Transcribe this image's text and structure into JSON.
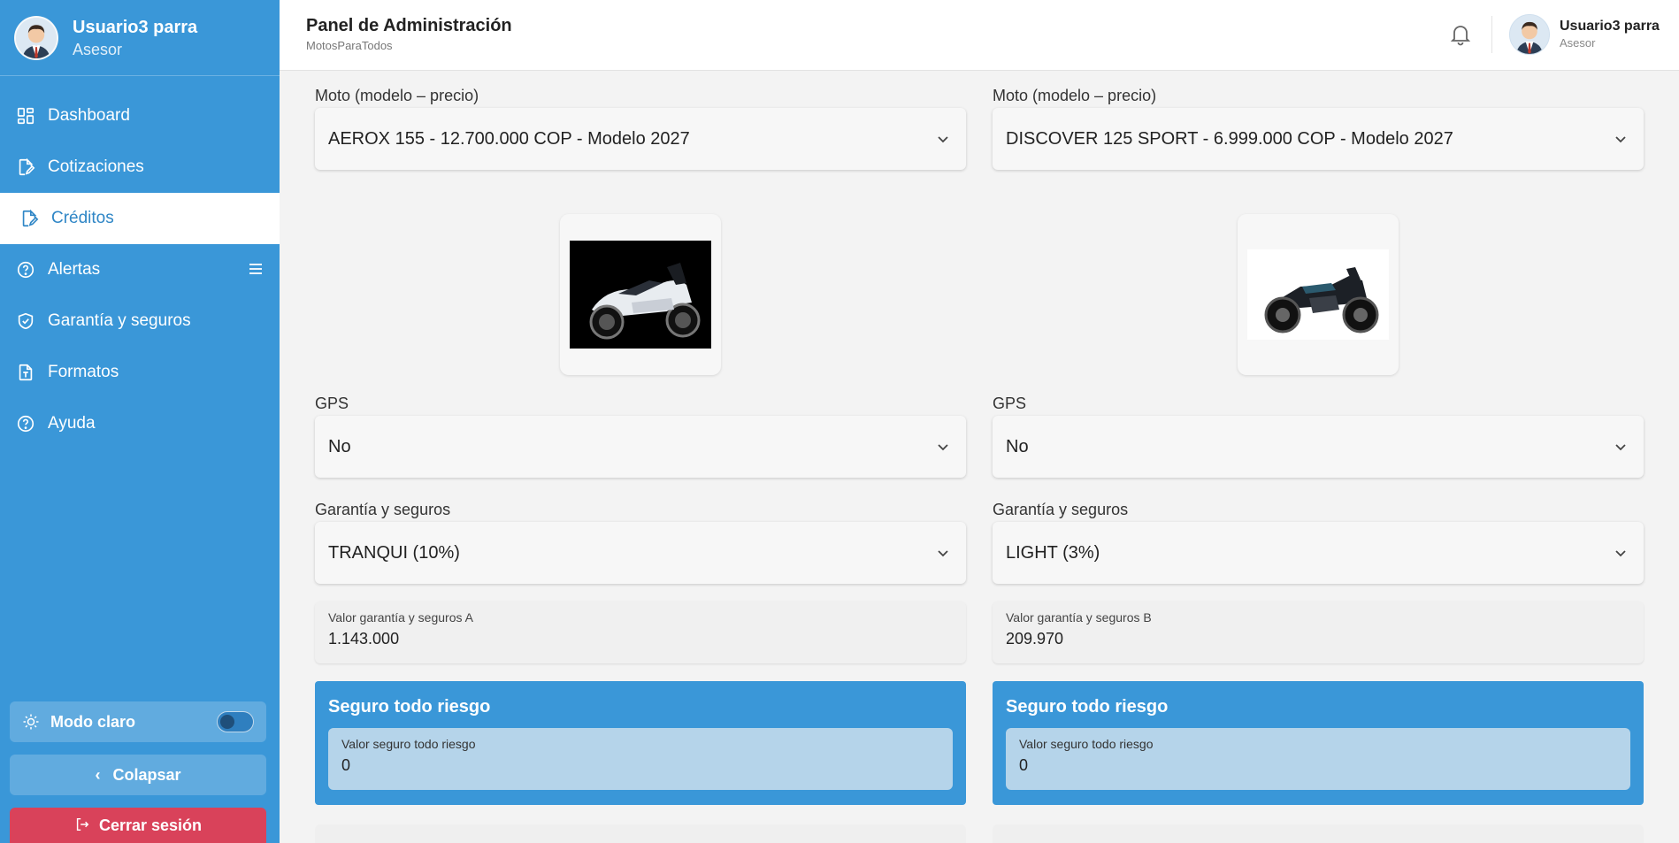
{
  "sidebar": {
    "user_name": "Usuario3 parra",
    "user_role": "Asesor",
    "items": [
      {
        "label": "Dashboard",
        "icon": "dashboard-icon"
      },
      {
        "label": "Cotizaciones",
        "icon": "document-edit-icon"
      },
      {
        "label": "Créditos",
        "icon": "document-edit-icon",
        "active": true
      },
      {
        "label": "Alertas",
        "icon": "help-circle-icon"
      },
      {
        "label": "Garantía y seguros",
        "icon": "shield-check-icon"
      },
      {
        "label": "Formatos",
        "icon": "document-text-icon"
      },
      {
        "label": "Ayuda",
        "icon": "help-circle-icon"
      }
    ],
    "mode_label": "Modo claro",
    "mode_toggle_on": false,
    "collapse_label": "Colapsar",
    "logout_label": "Cerrar sesión"
  },
  "header": {
    "title": "Panel de Administración",
    "subtitle": "MotosParaTodos",
    "user_name": "Usuario3 parra",
    "user_role": "Asesor"
  },
  "columns": [
    {
      "moto_label": "Moto (modelo – precio)",
      "moto_value": "AEROX 155 - 12.700.000 COP - Modelo 2027",
      "gps_label": "GPS",
      "gps_value": "No",
      "garantia_label": "Garantía y seguros",
      "garantia_value": "TRANQUI (10%)",
      "valor_garantia_label": "Valor garantía y seguros A",
      "valor_garantia_value": "1.143.000",
      "seguro_title": "Seguro todo riesgo",
      "seguro_label": "Valor seguro todo riesgo",
      "seguro_value": "0"
    },
    {
      "moto_label": "Moto (modelo – precio)",
      "moto_value": "DISCOVER 125 SPORT - 6.999.000 COP - Modelo 2027",
      "gps_label": "GPS",
      "gps_value": "No",
      "garantia_label": "Garantía y seguros",
      "garantia_value": "LIGHT (3%)",
      "valor_garantia_label": "Valor garantía y seguros B",
      "valor_garantia_value": "209.970",
      "seguro_title": "Seguro todo riesgo",
      "seguro_label": "Valor seguro todo riesgo",
      "seguro_value": "0"
    }
  ],
  "colors": {
    "sidebar_bg": "#3a97d8",
    "accent": "#2f86c6",
    "logout_bg": "#d9425a"
  }
}
